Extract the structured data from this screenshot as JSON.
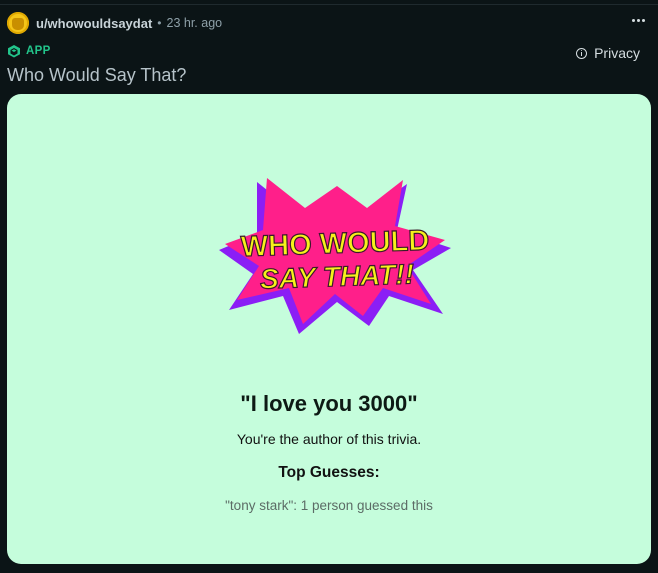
{
  "post": {
    "username": "u/whowouldsaydat",
    "separator": "•",
    "time": "23 hr. ago",
    "app_label": "APP",
    "privacy_label": "Privacy",
    "title": "Who Would Say That?"
  },
  "game": {
    "logo_line1": "WHO WOULD",
    "logo_line2": "SAY THAT!!",
    "quote": "\"I love you 3000\"",
    "author_note": "You're the author of this trivia.",
    "top_guesses_title": "Top Guesses:",
    "guesses": [
      "\"tony stark\": 1 person guessed this"
    ]
  },
  "colors": {
    "background": "#0b1416",
    "card": "#c5fddc",
    "app_accent": "#22c58b",
    "logo_pink": "#ff1f8a",
    "logo_purple": "#8b1ef5",
    "logo_text": "#f6f21a"
  },
  "icons": {
    "avatar": "avatar-image",
    "app": "app-cube-icon",
    "privacy": "info-icon",
    "more": "more-options-icon"
  }
}
